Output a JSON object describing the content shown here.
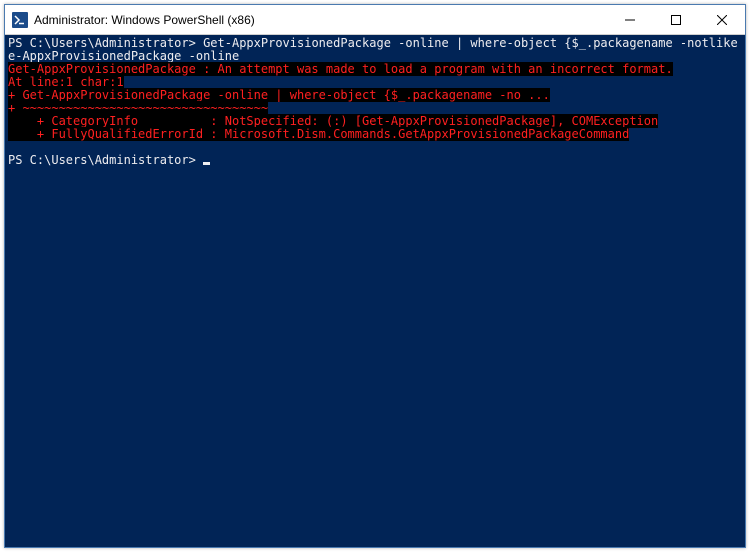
{
  "window": {
    "title": "Administrator: Windows PowerShell (x86)"
  },
  "terminal": {
    "prompt1_prefix": "PS C:\\Users\\Administrator> ",
    "command_line1": "Get-AppxProvisionedPackage -online | where-object {$_.packagename -notlike \"*store*\"} | Remov",
    "command_line2": "e-AppxProvisionedPackage -online",
    "error1": "Get-AppxProvisionedPackage : An attempt was made to load a program with an incorrect format.",
    "error2": "At line:1 char:1",
    "error3": "+ Get-AppxProvisionedPackage -online | where-object {$_.packagename -no ...",
    "error4": "+ ~~~~~~~~~~~~~~~~~~~~~~~~~~~~~~~~~~",
    "error5": "    + CategoryInfo          : NotSpecified: (:) [Get-AppxProvisionedPackage], COMException",
    "error6": "    + FullyQualifiedErrorId : Microsoft.Dism.Commands.GetAppxProvisionedPackageCommand",
    "blank": " ",
    "prompt2": "PS C:\\Users\\Administrator> "
  },
  "colors": {
    "terminal_bg": "#012456",
    "terminal_fg": "#eeedf0",
    "error_fg": "#ff2020",
    "error_bg": "#000000"
  }
}
